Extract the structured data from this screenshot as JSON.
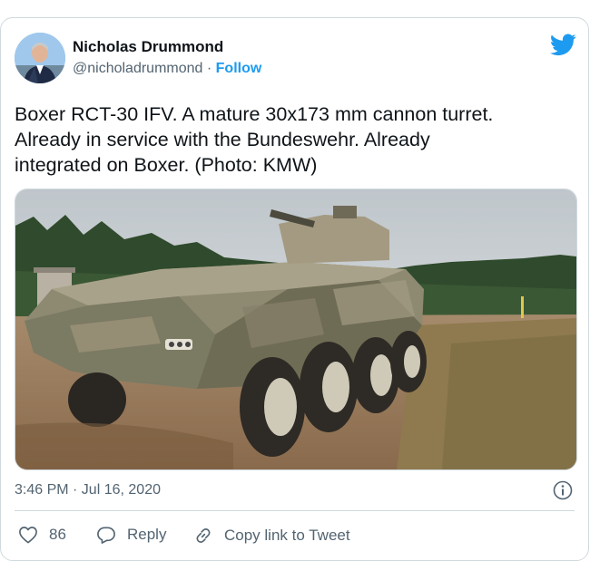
{
  "author": {
    "name": "Nicholas Drummond",
    "handle": "@nicholadrummond",
    "separator": " · ",
    "follow_label": "Follow"
  },
  "tweet": {
    "text_line1": "Boxer RCT-30 IFV. A mature 30x173 mm cannon turret.",
    "text_line2": "Already in service with the Bundeswehr. Already",
    "text_line3": "integrated on Boxer. (Photo: KMW)"
  },
  "meta": {
    "timestamp": "3:46 PM · Jul 16, 2020"
  },
  "actions": {
    "like_count": "86",
    "reply_label": "Reply",
    "copy_link_label": "Copy link to Tweet"
  },
  "colors": {
    "accent": "#1d9bf0",
    "secondary_text": "#536471",
    "border": "#cfd9de"
  }
}
